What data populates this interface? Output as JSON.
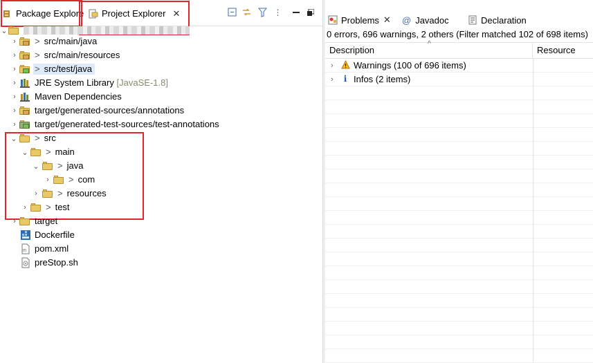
{
  "left": {
    "tabs": [
      {
        "label": "Package Explorer",
        "icon": "package-explorer-icon"
      },
      {
        "label": "Project Explorer",
        "icon": "project-explorer-icon",
        "active": true
      }
    ],
    "project_root_label": "",
    "tree": [
      {
        "label": "src/main/java",
        "prefix": ">"
      },
      {
        "label": "src/main/resources",
        "prefix": ">"
      },
      {
        "label": "src/test/java",
        "prefix": ">"
      },
      {
        "label": "JRE System Library",
        "suffix": "[JavaSE-1.8]"
      },
      {
        "label": "Maven Dependencies"
      },
      {
        "label": "target/generated-sources/annotations"
      },
      {
        "label": "target/generated-test-sources/test-annotations"
      },
      {
        "label": "src",
        "prefix": ">"
      },
      {
        "label": "main",
        "prefix": ">"
      },
      {
        "label": "java",
        "prefix": ">"
      },
      {
        "label": "com",
        "prefix": ">"
      },
      {
        "label": "resources",
        "prefix": ">"
      },
      {
        "label": "test",
        "prefix": ">"
      },
      {
        "label": "target"
      },
      {
        "label": "Dockerfile"
      },
      {
        "label": "pom.xml"
      },
      {
        "label": "preStop.sh"
      }
    ]
  },
  "right": {
    "tabs": [
      {
        "label": "Problems",
        "icon": "problems-icon",
        "active": true
      },
      {
        "label": "Javadoc",
        "icon": "at-sign-icon"
      },
      {
        "label": "Declaration",
        "icon": "declaration-icon"
      }
    ],
    "status": "0 errors, 696 warnings, 2 others (Filter matched 102 of 698 items)",
    "columns": {
      "description": "Description",
      "resource": "Resource"
    },
    "rows": [
      {
        "label": "Warnings (100 of 696 items)",
        "icon": "warning-icon"
      },
      {
        "label": "Infos (2 items)",
        "icon": "info-icon"
      }
    ]
  },
  "colors": {
    "highlight_box": "#e0262c",
    "selection": "#ddeaf8",
    "folder": "#e8c96a"
  }
}
